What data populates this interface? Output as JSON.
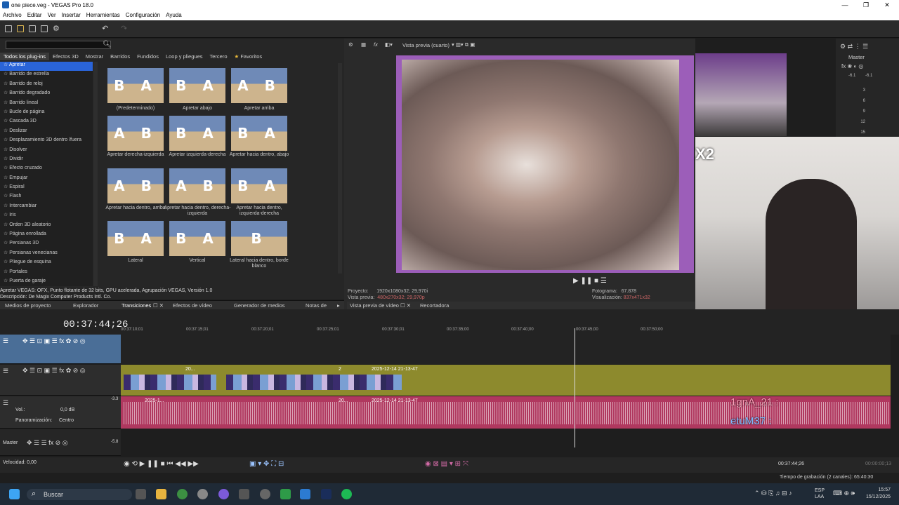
{
  "window": {
    "title": "one piece.veg - VEGAS Pro 18.0",
    "minimize": "—",
    "maximize": "❐",
    "close": "✕"
  },
  "menu": [
    "Archivo",
    "Editar",
    "Ver",
    "Insertar",
    "Herramientas",
    "Configuración",
    "Ayuda"
  ],
  "plugin_tabs": [
    "Todos los plug-ins",
    "Efectos 3D",
    "Mostrar",
    "Barridos",
    "Fundidos",
    "Loop y pliegues",
    "Tercero",
    "Favoritos"
  ],
  "plugin_list": [
    "Apretar",
    "Barrido de estrella",
    "Barrido de reloj",
    "Barrido degradado",
    "Barrido lineal",
    "Bucle de página",
    "Cascada 3D",
    "Deslizar",
    "Desplazamiento 3D dentro /fuera",
    "Disolver",
    "Dividir",
    "Efecto cruzado",
    "Empujar",
    "Espiral",
    "Flash",
    "Intercambiar",
    "Iris",
    "Orden 3D aleatorio",
    "Página enrollada",
    "Persianas 3D",
    "Persianas venecianas",
    "Pliegue de esquina",
    "Portales",
    "Puerta de garaje"
  ],
  "presets": [
    {
      "glyph": "B A",
      "label": "(Predeterminado)"
    },
    {
      "glyph": "B A",
      "label": "Apretar abajo"
    },
    {
      "glyph": "A B",
      "label": "Apretar arriba"
    },
    {
      "glyph": "A B",
      "label": "Apretar derecha-izquierda"
    },
    {
      "glyph": "B A",
      "label": "Apretar izquierda-derecha"
    },
    {
      "glyph": "B A",
      "label": "Apretar hacia dentro, abajo"
    },
    {
      "glyph": "A B",
      "label": "Apretar hacia dentro, arriba"
    },
    {
      "glyph": "A B",
      "label": "Apretar hacia dentro, derecha-izquierda"
    },
    {
      "glyph": "B A",
      "label": "Apretar hacia dentro, izquierda-derecha"
    },
    {
      "glyph": "B A",
      "label": "Lateral"
    },
    {
      "glyph": "B A",
      "label": "Vertical"
    },
    {
      "glyph": "B",
      "label": "Lateral hacia dentro, borde blanco"
    }
  ],
  "description": [
    "Apretar VEGAS: OFX, Punto flotante de 32 bits, GPU acelerada, Agrupación VEGAS, Versión 1.0",
    "Descripción: De Magix Computer Products Intl. Co."
  ],
  "bottom_tabs": [
    "Medios de proyecto",
    "Explorador",
    "Transiciones",
    "Efectos de vídeo",
    "Generador de medios",
    "Notas de"
  ],
  "preview": {
    "mode": "Vista previa (cuarto)",
    "tabs": [
      "Vista previa de vídeo",
      "Recortadora"
    ],
    "project_label": "Proyecto:",
    "project": "1920x1080x32; 29,970i",
    "preview_label": "Vista previa:",
    "preview_val": "480x270x32; 29,970p",
    "frame_label": "Fotograma:",
    "frame": "67.878",
    "display_label": "Visualización:",
    "display": "837x471x32"
  },
  "master": {
    "label": "Master",
    "left": "-6.1",
    "right": "-6.1",
    "scale": [
      "3",
      "6",
      "9",
      "12",
      "15"
    ]
  },
  "timeline": {
    "time": "00:37:44;26",
    "ruler": [
      "00:37:10;01",
      "00:37:15;01",
      "00:37:20;01",
      "00:37:25;01",
      "00:37:30;01",
      "00:37:35;00",
      "00:37:40;00",
      "00:37:45;00",
      "00:37:50;00"
    ],
    "clip1": "20...",
    "clip2": "2",
    "clip3": "2025-12-14 21-13-47",
    "aclip1": "2025-1...",
    "aclip2": "20...",
    "aclip3": "2025-12-14 21-13-47",
    "vol_label": "Vol.:",
    "vol": "0,0 dB",
    "pan_label": "Panoramización:",
    "pan": "Centro",
    "master_label": "Master",
    "vu1": "-3.3",
    "vu2": "-5.8"
  },
  "overlay": {
    "user1": "1gnA_21 :",
    "user2": "etuM37 :",
    "x2": "X2"
  },
  "transport": {
    "rate": "Velocidad: 0,00",
    "time_end": "00:37:44;26",
    "time_r": "00:00:00;13"
  },
  "status": {
    "rec": "Tiempo de grabación (2 canales): 65:40:30"
  },
  "taskbar": {
    "search": "Buscar",
    "lang1": "ESP",
    "lang2": "LAA",
    "clock": "15:57",
    "date": "15/12/2025"
  }
}
